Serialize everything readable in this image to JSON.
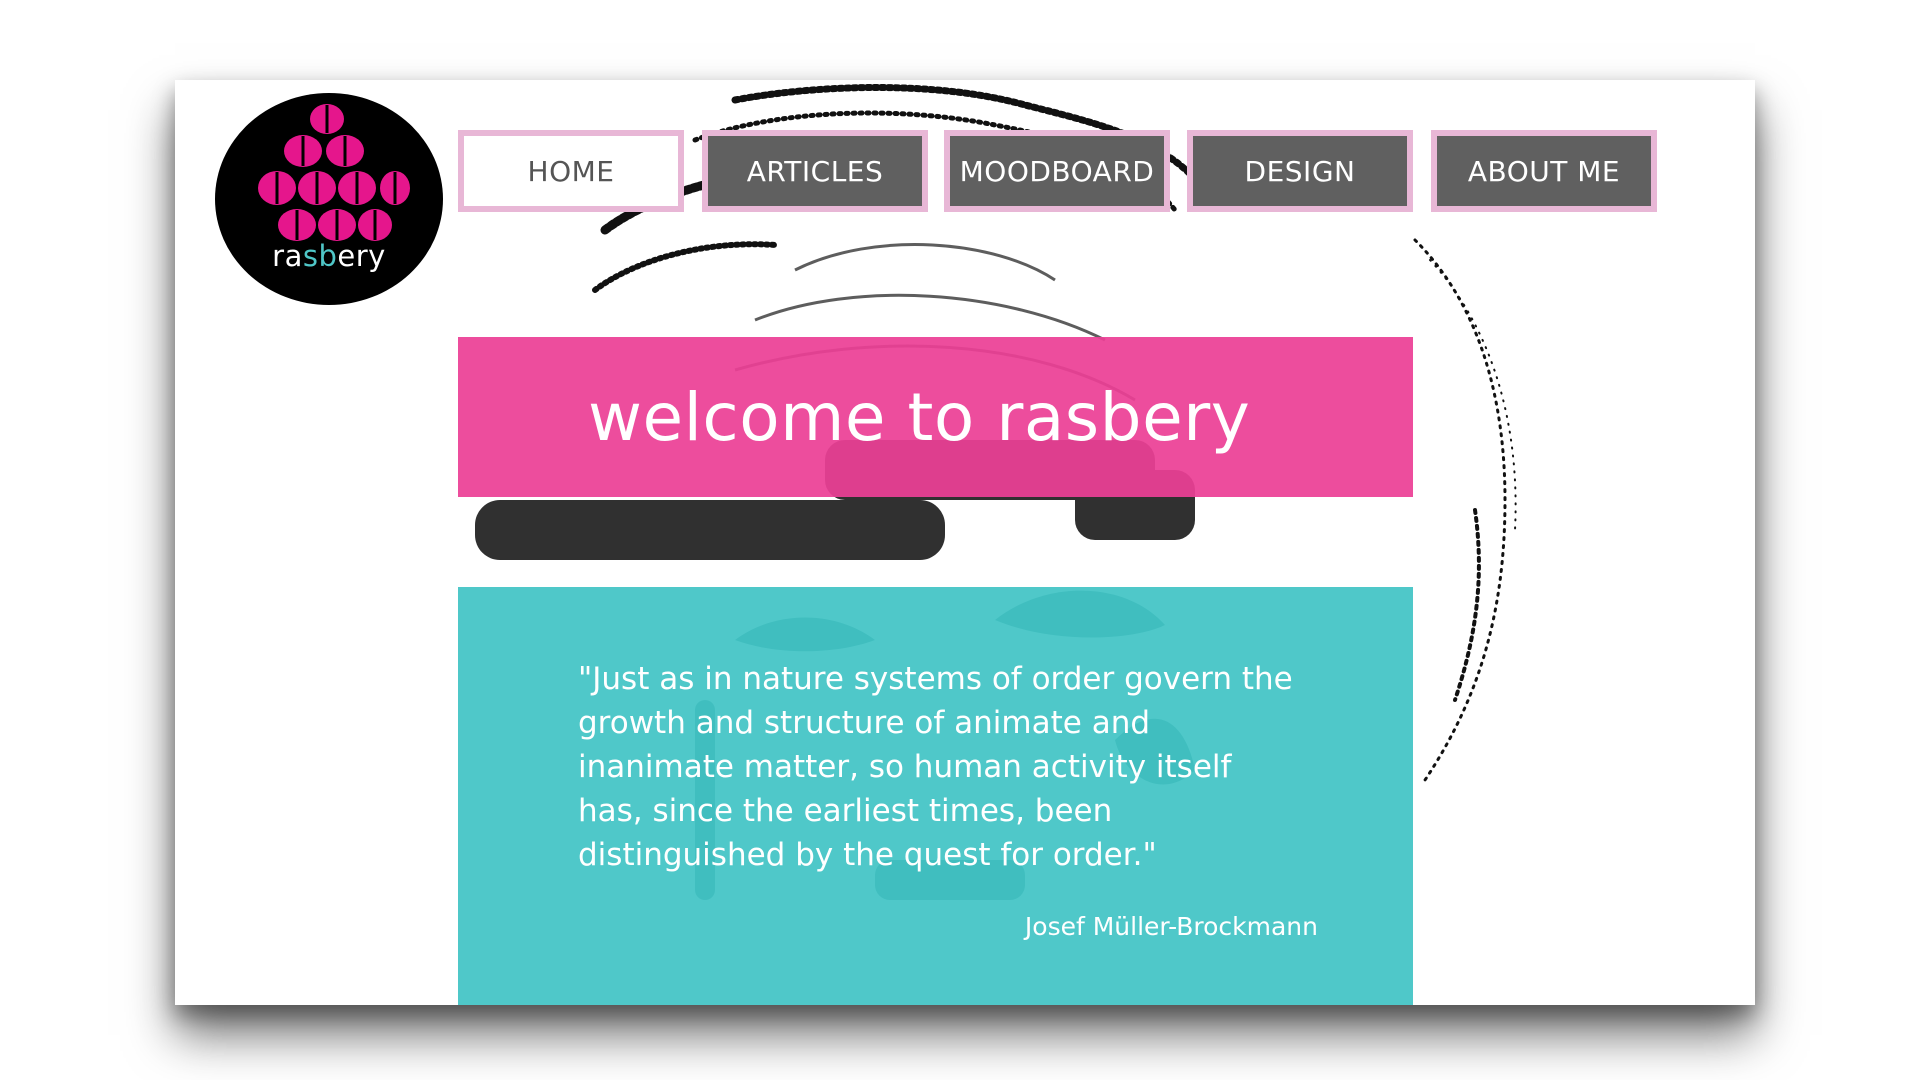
{
  "logo": {
    "word_start": "ra",
    "word_accent": "sb",
    "word_end": "ery",
    "colors": {
      "berry": "#e5168c",
      "background": "#000000",
      "accent": "#4fc6c7"
    }
  },
  "nav": {
    "items": [
      {
        "label": "HOME",
        "active": true
      },
      {
        "label": "ARTICLES",
        "active": false
      },
      {
        "label": "MOODBOARD",
        "active": false
      },
      {
        "label": "DESIGN",
        "active": false
      },
      {
        "label": "ABOUT ME",
        "active": false
      }
    ]
  },
  "hero": {
    "title": "welcome to rasbery"
  },
  "quote": {
    "text": "\"Just as in nature systems of order govern the growth and structure of animate and inanimate matter, so human activity itself has, since the earliest times, been distinguished by the quest for order.\"",
    "author": "Josef Müller-Brockmann"
  },
  "colors": {
    "pink": "#ec3f96",
    "teal": "#40c3c4",
    "nav_border": "#e8b7d6",
    "nav_fill": "#606060"
  }
}
